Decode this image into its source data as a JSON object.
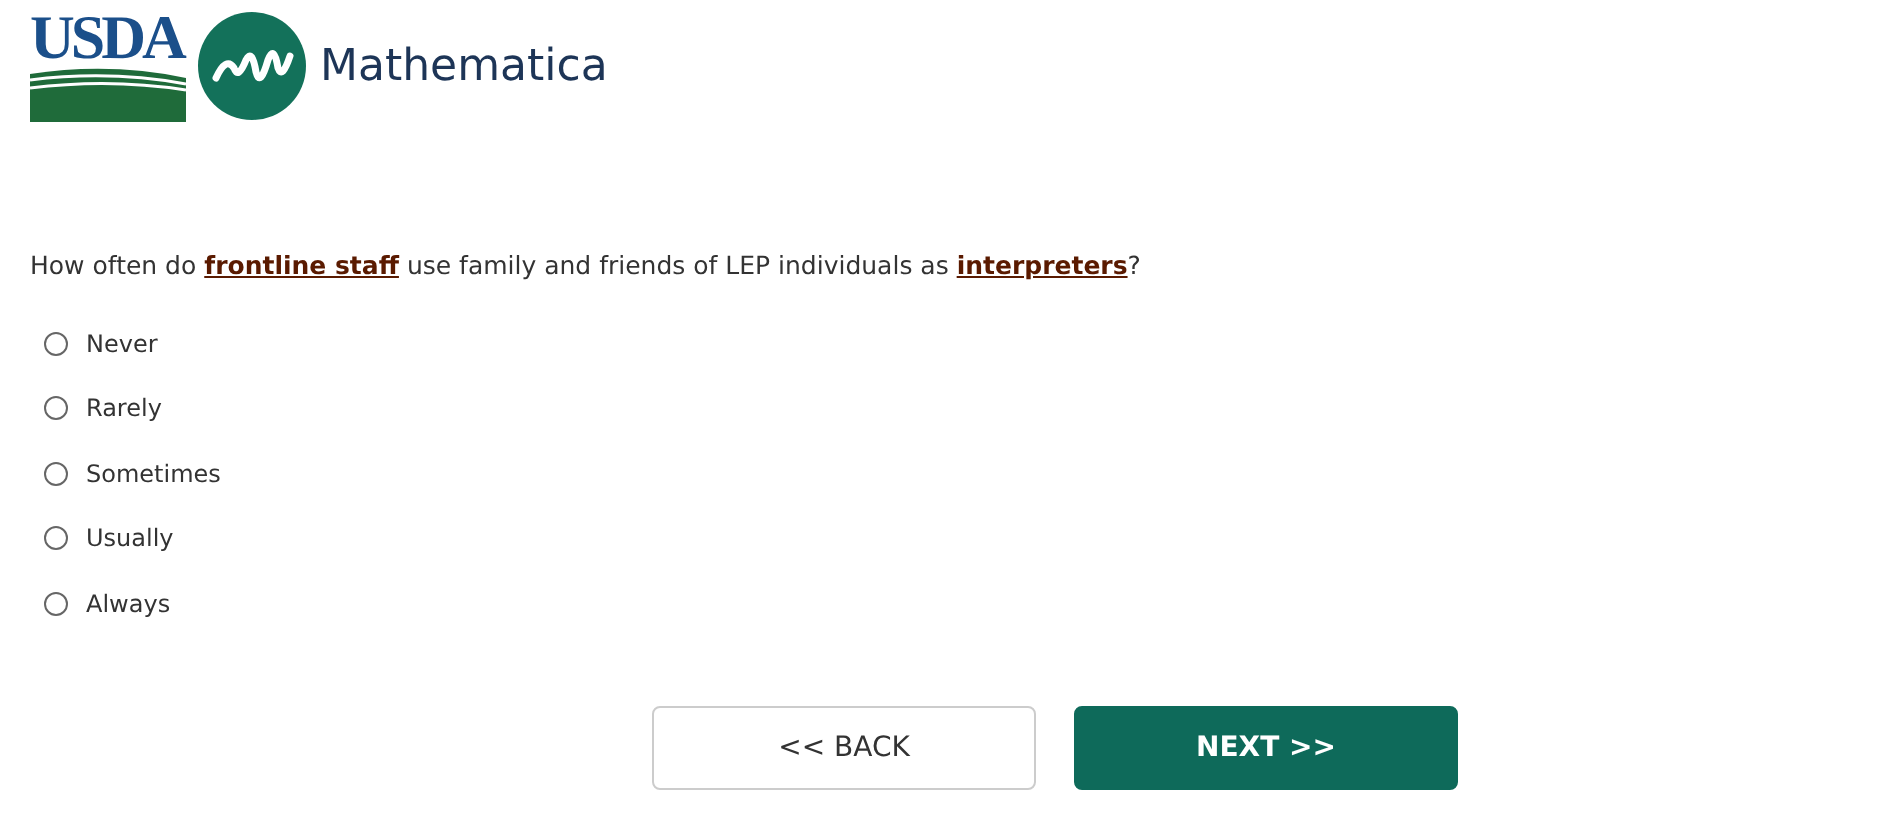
{
  "header": {
    "usda_logo": "USDA",
    "partner_logo": "Mathematica"
  },
  "question": {
    "parts": [
      {
        "kind": "text",
        "text": "How often do "
      },
      {
        "kind": "link",
        "text": "frontline staff"
      },
      {
        "kind": "text",
        "text": " use family and friends of LEP individuals as "
      },
      {
        "kind": "link",
        "text": "interpreters"
      },
      {
        "kind": "text",
        "text": "?"
      }
    ]
  },
  "options": [
    {
      "label": "Never",
      "selected": false
    },
    {
      "label": "Rarely",
      "selected": false
    },
    {
      "label": "Sometimes",
      "selected": false
    },
    {
      "label": "Usually",
      "selected": false
    },
    {
      "label": "Always",
      "selected": false
    }
  ],
  "buttons": [
    {
      "kind": "secondary",
      "label": "<< BACK"
    },
    {
      "kind": "primary",
      "label": "NEXT >>"
    }
  ]
}
